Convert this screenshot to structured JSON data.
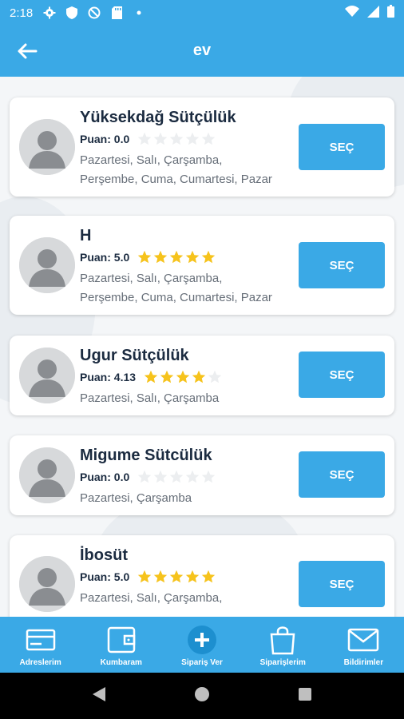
{
  "status_bar": {
    "time": "2:18",
    "left_icons": [
      "gear-icon",
      "shield-icon",
      "no-sim-icon",
      "sd-card-icon",
      "dot-icon"
    ],
    "right_icons": [
      "wifi-icon",
      "signal-icon",
      "battery-icon"
    ]
  },
  "app_bar": {
    "title": "ev"
  },
  "suppliers": [
    {
      "name": "Yüksekdağ Sütçülük",
      "rating_label": "Puan: 0.0",
      "rating": 0.0,
      "days_line1": "Pazartesi, Salı, Çarşamba,",
      "days_line2": "Perşembe, Cuma, Cumartesi, Pazar",
      "button": "SEÇ"
    },
    {
      "name": "H",
      "rating_label": "Puan: 5.0",
      "rating": 5.0,
      "days_line1": "Pazartesi, Salı, Çarşamba,",
      "days_line2": "Perşembe, Cuma, Cumartesi, Pazar",
      "button": "SEÇ"
    },
    {
      "name": "Ugur Sütçülük",
      "rating_label": "Puan: 4.13",
      "rating": 4.13,
      "days_line1": "Pazartesi, Salı, Çarşamba",
      "days_line2": "",
      "button": "SEÇ"
    },
    {
      "name": "Migume Sütcülük",
      "rating_label": "Puan: 0.0",
      "rating": 0.0,
      "days_line1": "Pazartesi, Çarşamba",
      "days_line2": "",
      "button": "SEÇ"
    },
    {
      "name": "İbosüt",
      "rating_label": "Puan: 5.0",
      "rating": 5.0,
      "days_line1": "Pazartesi, Salı, Çarşamba,",
      "days_line2": "",
      "button": "SEÇ"
    }
  ],
  "bottom_nav": [
    {
      "label": "Adreslerim",
      "icon": "card-icon"
    },
    {
      "label": "Kumbaram",
      "icon": "wallet-icon"
    },
    {
      "label": "Sipariş Ver",
      "icon": "plus-circle-icon"
    },
    {
      "label": "Siparişlerim",
      "icon": "shopping-bag-icon"
    },
    {
      "label": "Bildirimler",
      "icon": "mail-icon"
    }
  ],
  "colors": {
    "primary": "#3aa9e6",
    "star_filled": "#f6c31c",
    "star_empty": "#eceef0",
    "title_text": "#1b2b40"
  }
}
